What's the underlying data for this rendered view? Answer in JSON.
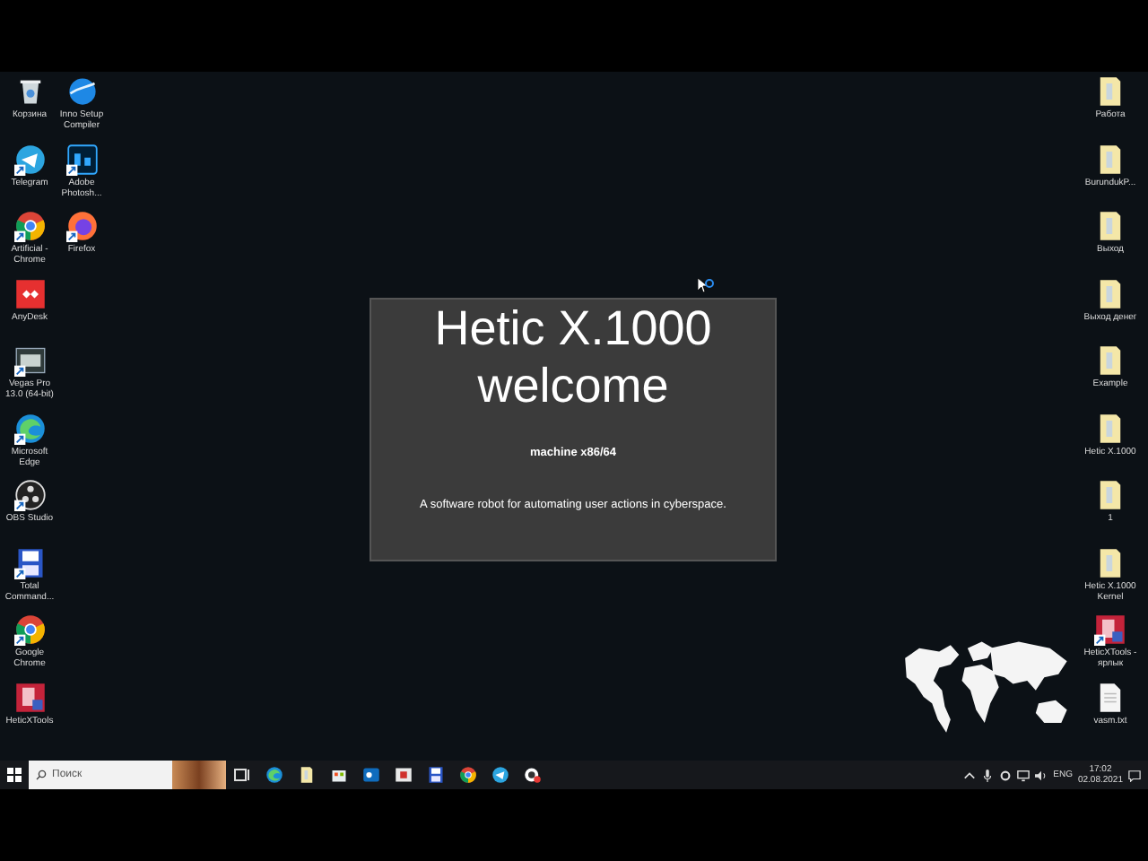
{
  "desktop": {
    "left_icons": [
      {
        "label": "Корзина",
        "kind": "recycle-bin",
        "shortcut": false
      },
      {
        "label": "Telegram",
        "kind": "telegram",
        "shortcut": true
      },
      {
        "label": "Artificial - Chrome",
        "kind": "chrome",
        "shortcut": true
      },
      {
        "label": "AnyDesk",
        "kind": "anydesk",
        "shortcut": false
      },
      {
        "label": "Vegas Pro 13.0 (64-bit)",
        "kind": "vegas",
        "shortcut": true
      },
      {
        "label": "Microsoft Edge",
        "kind": "edge",
        "shortcut": true
      },
      {
        "label": "OBS Studio",
        "kind": "obs",
        "shortcut": true
      },
      {
        "label": "Total Command...",
        "kind": "floppy",
        "shortcut": true
      },
      {
        "label": "Google Chrome",
        "kind": "chrome",
        "shortcut": true
      },
      {
        "label": "HeticXTools",
        "kind": "toolbox",
        "shortcut": false
      },
      {
        "label": "Inno Setup Compiler",
        "kind": "globe",
        "shortcut": false
      },
      {
        "label": "Adobe Photosh...",
        "kind": "photoshop",
        "shortcut": true
      },
      {
        "label": "Firefox",
        "kind": "firefox",
        "shortcut": true
      }
    ],
    "right_icons": [
      {
        "label": "Работа",
        "kind": "folder",
        "shortcut": false
      },
      {
        "label": "BurundukP...",
        "kind": "folder",
        "shortcut": false
      },
      {
        "label": "Выход",
        "kind": "folder",
        "shortcut": false
      },
      {
        "label": "Выход денег",
        "kind": "folder",
        "shortcut": false
      },
      {
        "label": "Example",
        "kind": "folder",
        "shortcut": false
      },
      {
        "label": "Hetic X.1000",
        "kind": "folder",
        "shortcut": false
      },
      {
        "label": "1",
        "kind": "folder",
        "shortcut": false
      },
      {
        "label": "Hetic X.1000 Kernel",
        "kind": "folder",
        "shortcut": false
      },
      {
        "label": "HeticXTools - ярлык",
        "kind": "toolbox",
        "shortcut": true
      },
      {
        "label": "vasm.txt",
        "kind": "text-file",
        "shortcut": false
      }
    ]
  },
  "splash": {
    "title_lines": [
      "Hetic X.1000",
      "welcome"
    ],
    "machine": "machine x86/64",
    "tagline": "A software robot for automating user actions in cyberspace."
  },
  "taskbar": {
    "search": {
      "placeholder": "Поиск"
    },
    "apps": [
      {
        "kind": "edge"
      },
      {
        "kind": "folder"
      },
      {
        "kind": "store"
      },
      {
        "kind": "mail"
      },
      {
        "kind": "media"
      },
      {
        "kind": "floppy"
      },
      {
        "kind": "chrome"
      },
      {
        "kind": "telegram"
      },
      {
        "kind": "record"
      }
    ],
    "language": "ENG",
    "time": "17:02",
    "date": "02.08.2021"
  }
}
